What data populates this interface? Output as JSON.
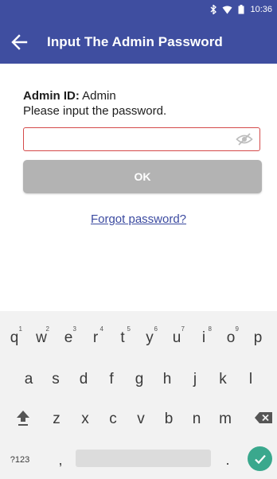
{
  "status_bar": {
    "time": "10:36",
    "icons": [
      "bluetooth-icon",
      "wifi-icon",
      "battery-icon"
    ]
  },
  "app_bar": {
    "title": "Input The Admin Password",
    "back_icon": "back-arrow-icon"
  },
  "form": {
    "admin_id_label": "Admin ID:",
    "admin_id_value": "Admin",
    "prompt": "Please input the password.",
    "password_value": "",
    "password_placeholder": "",
    "visibility_icon": "eye-off-icon",
    "ok_label": "OK",
    "forgot_label": "Forgot password?"
  },
  "keyboard": {
    "row1": [
      {
        "key": "q",
        "hint": "1"
      },
      {
        "key": "w",
        "hint": "2"
      },
      {
        "key": "e",
        "hint": "3"
      },
      {
        "key": "r",
        "hint": "4"
      },
      {
        "key": "t",
        "hint": "5"
      },
      {
        "key": "y",
        "hint": "6"
      },
      {
        "key": "u",
        "hint": "7"
      },
      {
        "key": "i",
        "hint": "8"
      },
      {
        "key": "o",
        "hint": "9"
      },
      {
        "key": "p",
        "hint": ""
      }
    ],
    "row2": [
      "a",
      "s",
      "d",
      "f",
      "g",
      "h",
      "j",
      "k",
      "l"
    ],
    "row3": [
      "z",
      "x",
      "c",
      "v",
      "b",
      "n",
      "m"
    ],
    "symbols_label": "?123",
    "comma": ",",
    "period": ".",
    "shift_icon": "shift-icon",
    "backspace_icon": "backspace-icon",
    "enter_icon": "checkmark-icon"
  },
  "colors": {
    "primary": "#3f4ea0",
    "error_border": "#d44a4a",
    "button_disabled": "#b3b3b3",
    "link": "#3b4aa0",
    "enter_key": "#3aa88d"
  }
}
